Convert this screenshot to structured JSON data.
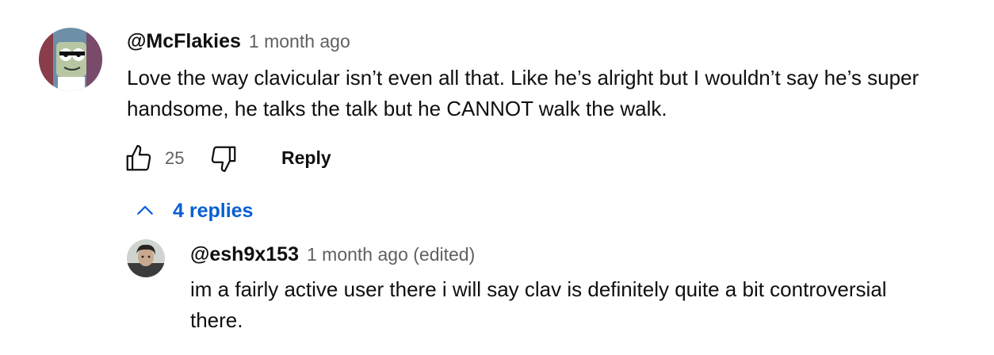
{
  "comment": {
    "handle": "@McFlakies",
    "time": "1 month ago",
    "text_line1": "Love the way clavicular isn’t even all that. Like he’s alright but I wouldn’t say he’s super",
    "text_line2": "handsome, he talks the talk but he CANNOT walk the walk.",
    "likes": "25",
    "reply_label": "Reply",
    "icons": [
      "like-icon",
      "dislike-icon"
    ]
  },
  "replies_toggle": {
    "label": "4 replies",
    "icon": "chevron-up-icon",
    "color": "#065fd4"
  },
  "reply": {
    "handle": "@esh9x153",
    "time": "1 month ago (edited)",
    "text_line1": "im a fairly active user there i will say clav is definitely quite a bit controversial",
    "text_line2": "there."
  }
}
